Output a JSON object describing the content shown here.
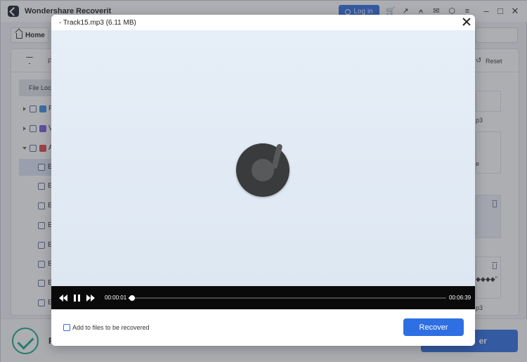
{
  "app": {
    "title": "Wondershare Recoverit",
    "login_label": "Log in",
    "home_label": "Home",
    "filter_partial": "F",
    "reset_label": "Reset",
    "file_location_label": "File Loc",
    "tree_letters": [
      "P",
      "V",
      "A"
    ],
    "file_rows_letter": "E",
    "bottom_letter": "R",
    "bottom_recover_label": "er",
    "right_snippets": [
      "p3",
      "e",
      "◆◆◆◆\"",
      "p3"
    ]
  },
  "icons": [
    "cart-icon",
    "export-icon",
    "headset-icon",
    "mail-icon",
    "box-icon",
    "menu-icon"
  ],
  "modal": {
    "title": "- Track15.mp3 (6.11 MB)",
    "player": {
      "current_time": "00:00:01",
      "total_time": "00:06:39",
      "progress": 0.003
    },
    "add_label": "Add to files to be recovered",
    "recover_label": "Recover"
  },
  "colors": {
    "accent": "#2f6fe4",
    "success": "#1ba88a",
    "player_bg": "#0a0a0a"
  }
}
